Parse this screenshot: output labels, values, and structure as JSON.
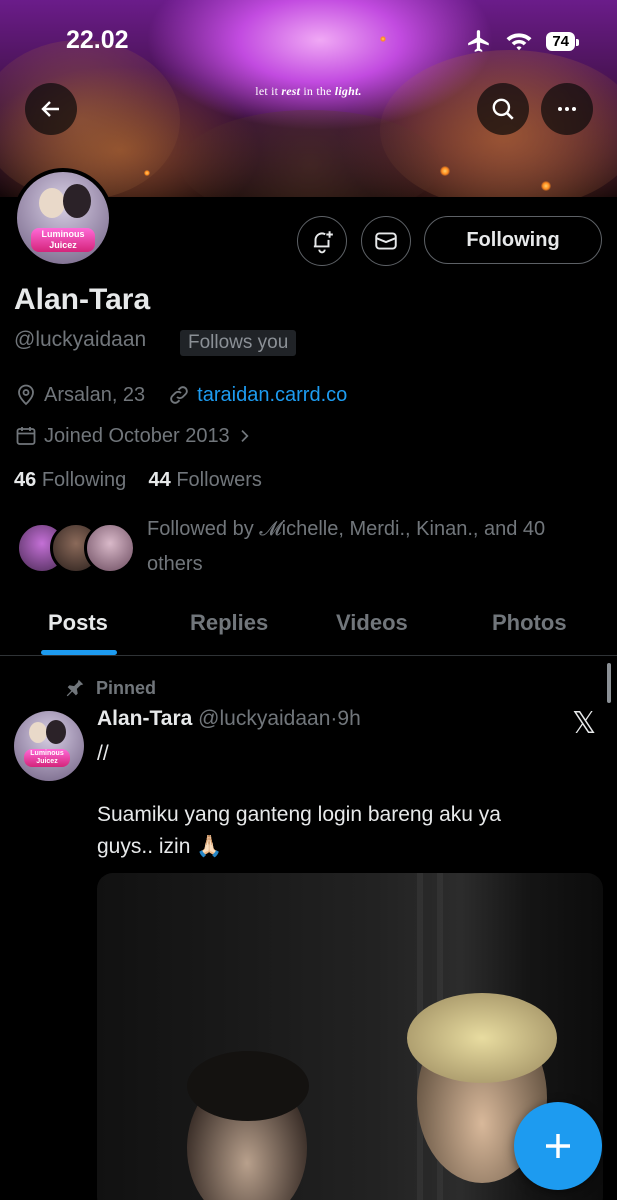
{
  "status_bar": {
    "time": "22.02",
    "battery": "74"
  },
  "banner": {
    "text_before": "let it",
    "text_rest": "rest",
    "text_middle": "in the",
    "text_light": "light."
  },
  "profile": {
    "name": "Alan-Tara",
    "handle": "@luckyaidaan",
    "follows_you": "Follows you",
    "location": "Arsalan, 23",
    "website": "taraidan.carrd.co",
    "joined": "Joined October 2013",
    "following_count": "46",
    "following_label": "Following",
    "followers_count": "44",
    "followers_label": "Followers",
    "followed_by": "Followed by 𝓜ichelle, Merdi., Kinan., and 40 others",
    "follow_button": "Following",
    "avatar_logo_text": "Luminous Juicez"
  },
  "tabs": [
    "Posts",
    "Replies",
    "Videos",
    "Photos"
  ],
  "post": {
    "pinned_label": "Pinned",
    "author": "Alan-Tara",
    "handle": "@luckyaidaan",
    "separator": "·",
    "time": "9h",
    "line1": "//",
    "line2": "Suamiku yang ganteng login bareng aku ya",
    "line3": "guys.. izin 🙏🏻"
  },
  "colors": {
    "accent": "#1d9bf0",
    "background": "#000000",
    "muted": "#71767b",
    "text": "#e7e9ea"
  }
}
